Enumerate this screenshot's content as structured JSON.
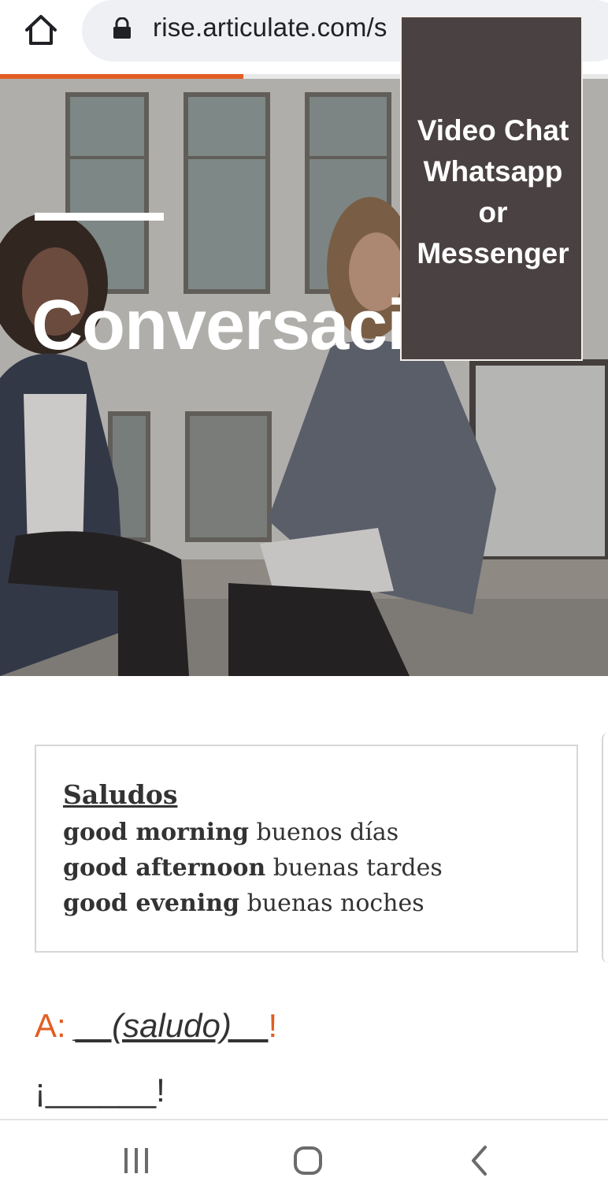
{
  "browser": {
    "url": "rise.articulate.com/s",
    "progress_percent": 40,
    "accent_color": "#e25d22",
    "icons": [
      "home-icon",
      "lock-icon"
    ]
  },
  "hero": {
    "title": "Conversació"
  },
  "overlay": {
    "line1": "Video Chat",
    "line2": "Whatsapp",
    "line3": "or",
    "line4": "Messenger"
  },
  "vocab_card": {
    "title": "Saludos",
    "rows": [
      {
        "en": "good morning",
        "es": "buenos días"
      },
      {
        "en": "good afternoon",
        "es": "buenas tardes"
      },
      {
        "en": "good evening",
        "es": "buenas noches"
      }
    ]
  },
  "prompt": {
    "prefix": "A: ",
    "blank": "__(saludo)__",
    "suffix": "!"
  },
  "answer": {
    "text": "¡______!"
  },
  "nav_bar": {
    "icons": [
      "recent-apps-icon",
      "home-circle-icon",
      "back-icon"
    ]
  }
}
